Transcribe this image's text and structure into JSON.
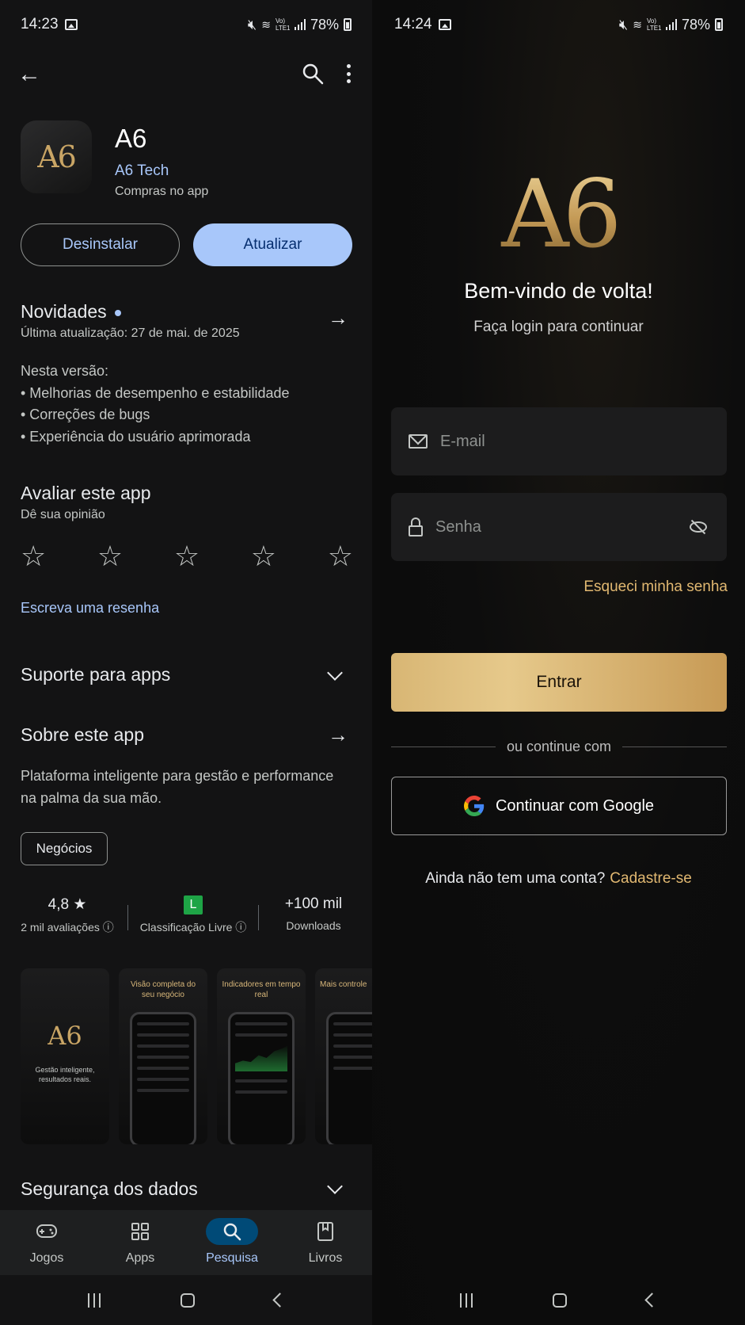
{
  "left": {
    "status": {
      "time": "14:23",
      "battery": "78%",
      "network": "Vo) LTE1"
    },
    "app": {
      "icon_text": "A6",
      "title": "A6",
      "developer": "A6 Tech",
      "subtitle": "Compras no app",
      "uninstall_label": "Desinstalar",
      "update_label": "Atualizar"
    },
    "whats_new": {
      "title": "Novidades",
      "updated": "Última atualização: 27 de mai. de 2025",
      "notes": [
        "Nesta versão:",
        "• Melhorias de desempenho e estabilidade",
        "• Correções de bugs",
        "• Experiência do usuário aprimorada"
      ]
    },
    "rate": {
      "title": "Avaliar este app",
      "subtitle": "Dê sua opinião",
      "stars": 5,
      "write_review": "Escreva uma resenha"
    },
    "support": {
      "title": "Suporte para apps"
    },
    "about": {
      "title": "Sobre este app",
      "text": "Plataforma inteligente para gestão e performance na palma da sua mão.",
      "category": "Negócios"
    },
    "stats": {
      "rating_value": "4,8 ★",
      "rating_label": "2 mil avaliações ⓘ",
      "content_badge": "L",
      "content_label": "Classificação Livre ⓘ",
      "downloads_value": "+100 mil",
      "downloads_label": "Downloads"
    },
    "screenshots": [
      {
        "logo": "A6",
        "tagline": "Gestão inteligente, resultados reais."
      },
      {
        "caption": "Visão completa do seu negócio"
      },
      {
        "caption": "Indicadores em tempo real"
      },
      {
        "caption": "Mais controle"
      }
    ],
    "data_safety": {
      "title": "Segurança dos dados"
    },
    "nav": [
      {
        "label": "Jogos",
        "icon": "gamepad-icon"
      },
      {
        "label": "Apps",
        "icon": "apps-grid-icon"
      },
      {
        "label": "Pesquisa",
        "icon": "search-icon",
        "active": true
      },
      {
        "label": "Livros",
        "icon": "book-icon"
      }
    ]
  },
  "right": {
    "status": {
      "time": "14:24",
      "battery": "78%",
      "network": "Vo) LTE1"
    },
    "logo": "A6",
    "welcome": "Bem-vindo de volta!",
    "subtitle": "Faça login para continuar",
    "email_placeholder": "E-mail",
    "password_placeholder": "Senha",
    "forgot": "Esqueci minha senha",
    "enter_label": "Entrar",
    "divider": "ou continue com",
    "google_label": "Continuar com Google",
    "signup_prompt": "Ainda não tem uma conta?",
    "signup_link": "Cadastre-se"
  },
  "colors": {
    "play_accent": "#a8c7fa",
    "play_bg": "#131314",
    "gold": "#e1b871",
    "login_bg": "#0d0d0d"
  }
}
